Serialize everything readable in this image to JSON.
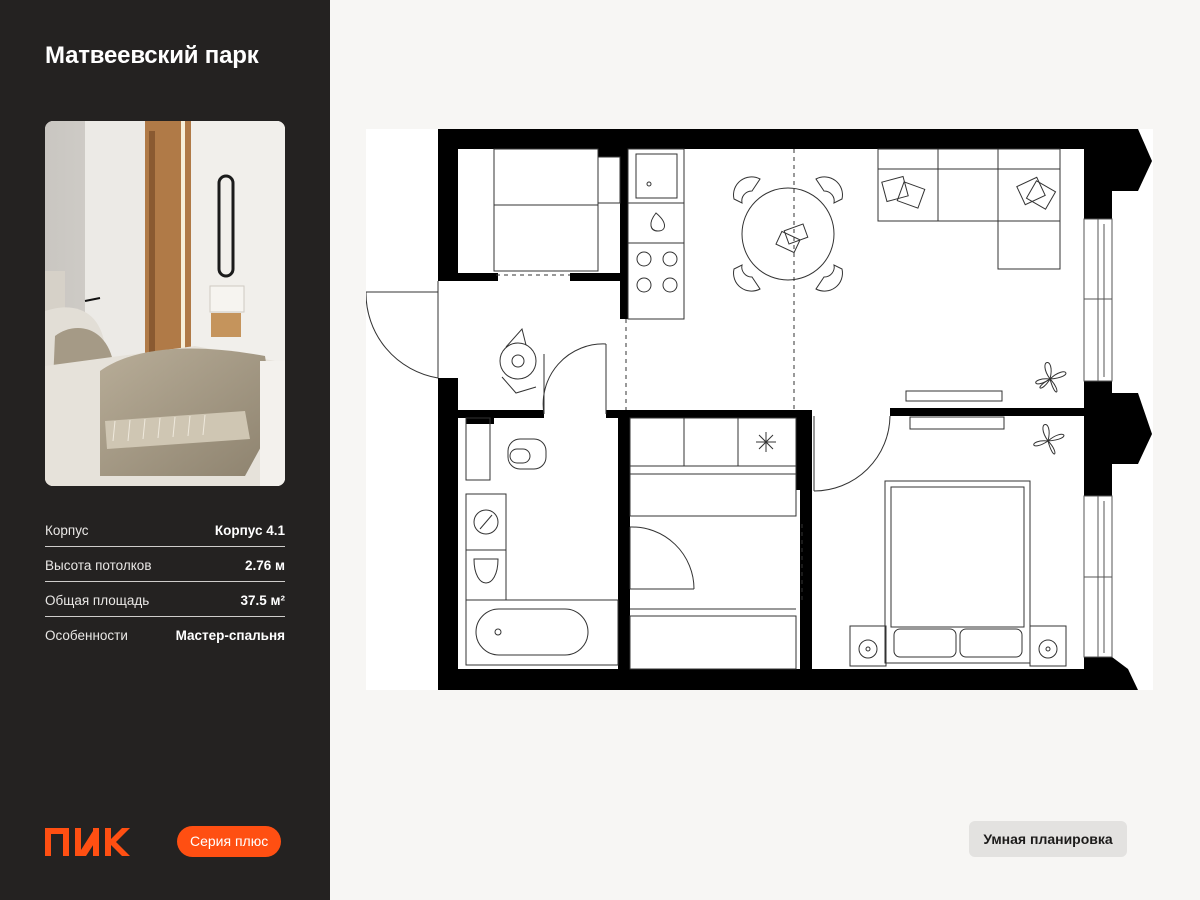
{
  "project": {
    "title": "Матвеевский парк"
  },
  "photo": {
    "subject": "bedroom-interior-photo"
  },
  "specs": [
    {
      "label": "Корпус",
      "value": "Корпус 4.1"
    },
    {
      "label": "Высота потолков",
      "value": "2.76 м"
    },
    {
      "label": "Общая площадь",
      "value": "37.5 м²"
    },
    {
      "label": "Особенности",
      "value": "Мастер-спальня"
    }
  ],
  "brand": {
    "logo_text": "ПИК",
    "series_badge": "Серия плюс"
  },
  "actions": {
    "smart_layout": "Умная планировка"
  },
  "colors": {
    "sidebar_bg": "#242221",
    "brand_orange": "#ff4f12",
    "page_bg": "#f7f6f4",
    "wall": "#000000"
  }
}
